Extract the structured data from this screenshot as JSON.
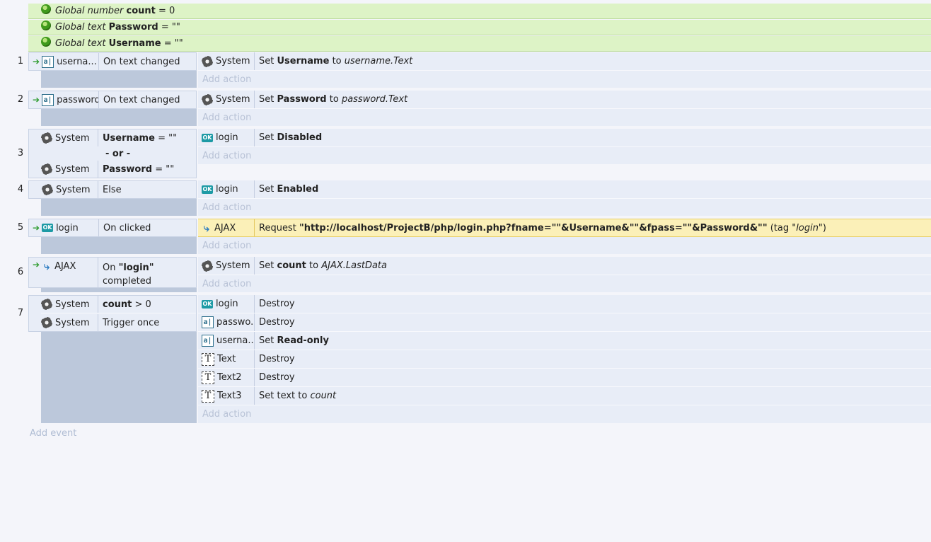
{
  "globals": [
    {
      "kind": "Global number",
      "name": "count",
      "value": "= 0"
    },
    {
      "kind": "Global text",
      "name": "Password",
      "value": "= \"\""
    },
    {
      "kind": "Global text",
      "name": "Username",
      "value": "= \"\""
    }
  ],
  "add_action": "Add action",
  "add_event": "Add event",
  "events": {
    "e1": {
      "num": "1",
      "cond_obj": "userna...",
      "cond": "On text changed",
      "act_obj": "System",
      "act_pre": "Set",
      "act_bold": "Username",
      "act_mid": "to",
      "act_it": "username.Text"
    },
    "e2": {
      "num": "2",
      "cond_obj": "password",
      "cond": "On text changed",
      "act_obj": "System",
      "act_pre": "Set",
      "act_bold": "Password",
      "act_mid": "to",
      "act_it": "password.Text"
    },
    "e3": {
      "num": "3",
      "c1_obj": "System",
      "c1_bold": "Username",
      "c1_rest": "= \"\"",
      "or": "- or -",
      "c2_obj": "System",
      "c2_bold": "Password",
      "c2_rest": "= \"\"",
      "act_obj": "login",
      "act_pre": "Set",
      "act_bold": "Disabled"
    },
    "e4": {
      "num": "4",
      "cond_obj": "System",
      "cond": "Else",
      "act_obj": "login",
      "act_pre": "Set",
      "act_bold": "Enabled"
    },
    "e5": {
      "num": "5",
      "cond_obj": "login",
      "cond": "On clicked",
      "act_obj": "AJAX",
      "act_pre": "Request",
      "act_bold": "\"http://localhost/ProjectB/php/login.php?fname=\"\"&Username&\"\"&fpass=\"\"&Password&\"\"",
      "act_tag_pre": "(tag",
      "act_tag": "\"login\"",
      "act_tag_post": ")"
    },
    "e6": {
      "num": "6",
      "cond_obj": "AJAX",
      "cond_pre": "On",
      "cond_bold": "\"login\"",
      "cond_post": "completed",
      "act_obj": "System",
      "act_pre": "Set",
      "act_bold": "count",
      "act_mid": "to",
      "act_it": "AJAX.LastData"
    },
    "e7": {
      "num": "7",
      "c1_obj": "System",
      "c1_bold": "count",
      "c1_rest": "> 0",
      "c2_obj": "System",
      "c2_text": "Trigger once",
      "actions": [
        {
          "obj": "login",
          "text": "Destroy"
        },
        {
          "obj": "passwo...",
          "text": "Destroy"
        },
        {
          "obj": "userna...",
          "pre": "Set",
          "bold": "Read-only"
        },
        {
          "obj": "Text",
          "text": "Destroy"
        },
        {
          "obj": "Text2",
          "text": "Destroy"
        },
        {
          "obj": "Text3",
          "pre": "Set text to",
          "it": "count"
        }
      ]
    }
  },
  "icons": {
    "globe": "globe-icon",
    "gear": "gear-icon",
    "textbox": "textbox-icon",
    "button": "button-icon",
    "text": "text-object-icon",
    "ajax": "ajax-icon",
    "trigger": "trigger-arrow-icon"
  },
  "colors": {
    "global_bg": "#ddf3c6",
    "row_bg": "#e8edf7",
    "highlight": "#fbf0b8",
    "strip": "#bcc8db"
  }
}
